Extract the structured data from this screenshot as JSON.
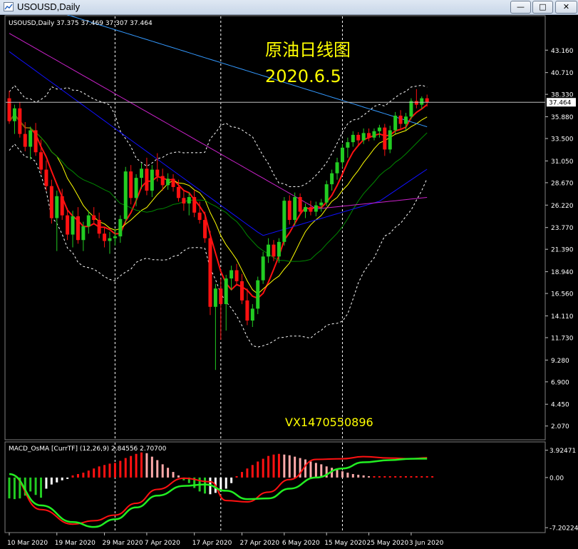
{
  "window": {
    "title": "USOUSD,Daily",
    "minimize_glyph": "—",
    "restore_glyph": "□",
    "close_glyph": "✕"
  },
  "colors": {
    "background": "#000000",
    "bull": "#22cc22",
    "bear": "#ff1111",
    "ma5": "#ff1111",
    "ma10": "#ffff00",
    "ma20": "#008800",
    "ma60": "#1010ff",
    "ma120": "#cc22cc",
    "ma240": "#3399ff",
    "band": "#ffffff",
    "macd_line": "#ff1111",
    "signal_line": "#22ee22",
    "hist_bear": "#ff1111",
    "hist_bull_pink": "#ffaaaa",
    "hist_white": "#ffffff",
    "hist_green": "#22cc22",
    "price_line": "#c0c0c0"
  },
  "chart_data": [
    {
      "type": "candlestick",
      "symbol_label": "USOUSD,Daily",
      "ohlc_readout": "37.375 37.469 37.307 37.464",
      "annotation_title": "原油日线图",
      "annotation_date": "2020.6.5",
      "watermark": "VX1470550896",
      "current_price_label": "37.464",
      "current_price": 37.464,
      "ylim": [
        0.8,
        45.6
      ],
      "y_ticks": [
        "43.160",
        "40.710",
        "38.330",
        "35.880",
        "33.500",
        "31.050",
        "28.670",
        "26.220",
        "23.770",
        "21.390",
        "18.940",
        "16.560",
        "14.110",
        "11.730",
        "9.280",
        "6.900",
        "4.450",
        "2.070"
      ],
      "x_ticks": [
        "10 Mar 2020",
        "19 Mar 2020",
        "29 Mar 2020",
        "7 Apr 2020",
        "17 Apr 2020",
        "27 Apr 2020",
        "6 May 2020",
        "15 May 2020",
        "25 May 2020",
        "3 Jun 2020"
      ],
      "x_tick_index": [
        0,
        9,
        18,
        26,
        35,
        44,
        52,
        60,
        68,
        76
      ],
      "period_separators_index": [
        -3,
        20,
        40,
        63
      ],
      "candles": [
        {
          "o": 37.9,
          "h": 38.7,
          "l": 35.1,
          "c": 35.4
        },
        {
          "o": 35.4,
          "h": 37.2,
          "l": 34.0,
          "c": 36.8
        },
        {
          "o": 36.8,
          "h": 37.5,
          "l": 33.6,
          "c": 34.0
        },
        {
          "o": 34.0,
          "h": 35.3,
          "l": 32.1,
          "c": 32.6
        },
        {
          "o": 32.6,
          "h": 34.8,
          "l": 31.2,
          "c": 34.4
        },
        {
          "o": 34.4,
          "h": 35.2,
          "l": 31.6,
          "c": 32.0
        },
        {
          "o": 32.0,
          "h": 33.4,
          "l": 29.6,
          "c": 30.1
        },
        {
          "o": 30.1,
          "h": 31.1,
          "l": 27.8,
          "c": 28.3
        },
        {
          "o": 28.3,
          "h": 29.0,
          "l": 24.2,
          "c": 24.8
        },
        {
          "o": 24.8,
          "h": 27.8,
          "l": 21.2,
          "c": 27.2
        },
        {
          "o": 27.2,
          "h": 28.0,
          "l": 24.6,
          "c": 25.1
        },
        {
          "o": 25.1,
          "h": 25.9,
          "l": 22.4,
          "c": 23.0
        },
        {
          "o": 23.0,
          "h": 25.6,
          "l": 21.6,
          "c": 25.0
        },
        {
          "o": 25.0,
          "h": 26.0,
          "l": 22.0,
          "c": 22.4
        },
        {
          "o": 22.4,
          "h": 24.4,
          "l": 21.2,
          "c": 23.9
        },
        {
          "o": 23.9,
          "h": 25.6,
          "l": 23.1,
          "c": 25.1
        },
        {
          "o": 25.1,
          "h": 26.0,
          "l": 24.2,
          "c": 24.6
        },
        {
          "o": 24.6,
          "h": 25.4,
          "l": 22.6,
          "c": 23.1
        },
        {
          "o": 23.1,
          "h": 23.8,
          "l": 21.6,
          "c": 22.3
        },
        {
          "o": 22.3,
          "h": 23.3,
          "l": 20.9,
          "c": 22.6
        },
        {
          "o": 22.6,
          "h": 23.6,
          "l": 21.8,
          "c": 22.8
        },
        {
          "o": 22.8,
          "h": 25.1,
          "l": 22.1,
          "c": 24.7
        },
        {
          "o": 24.7,
          "h": 30.4,
          "l": 24.2,
          "c": 29.9
        },
        {
          "o": 29.9,
          "h": 30.6,
          "l": 26.3,
          "c": 27.0
        },
        {
          "o": 27.0,
          "h": 29.6,
          "l": 26.1,
          "c": 29.2
        },
        {
          "o": 29.2,
          "h": 30.8,
          "l": 28.0,
          "c": 30.2
        },
        {
          "o": 30.2,
          "h": 31.4,
          "l": 27.3,
          "c": 27.8
        },
        {
          "o": 27.8,
          "h": 30.6,
          "l": 27.1,
          "c": 30.1
        },
        {
          "o": 30.1,
          "h": 31.9,
          "l": 28.8,
          "c": 29.4
        },
        {
          "o": 29.4,
          "h": 30.2,
          "l": 27.8,
          "c": 28.4
        },
        {
          "o": 28.4,
          "h": 29.7,
          "l": 27.9,
          "c": 29.1
        },
        {
          "o": 29.1,
          "h": 29.6,
          "l": 27.7,
          "c": 28.2
        },
        {
          "o": 28.2,
          "h": 29.0,
          "l": 26.6,
          "c": 27.0
        },
        {
          "o": 27.0,
          "h": 27.8,
          "l": 25.6,
          "c": 26.4
        },
        {
          "o": 26.4,
          "h": 27.6,
          "l": 25.1,
          "c": 27.1
        },
        {
          "o": 27.1,
          "h": 27.9,
          "l": 24.9,
          "c": 25.4
        },
        {
          "o": 25.4,
          "h": 26.6,
          "l": 24.2,
          "c": 24.6
        },
        {
          "o": 24.6,
          "h": 25.5,
          "l": 22.1,
          "c": 22.6
        },
        {
          "o": 22.6,
          "h": 23.4,
          "l": 14.2,
          "c": 15.1
        },
        {
          "o": 15.1,
          "h": 17.6,
          "l": 8.2,
          "c": 17.1
        },
        {
          "o": 17.1,
          "h": 18.2,
          "l": 11.5,
          "c": 15.4
        },
        {
          "o": 15.4,
          "h": 18.6,
          "l": 12.5,
          "c": 18.2
        },
        {
          "o": 18.2,
          "h": 19.6,
          "l": 16.9,
          "c": 19.1
        },
        {
          "o": 19.1,
          "h": 19.8,
          "l": 17.4,
          "c": 17.9
        },
        {
          "o": 17.9,
          "h": 18.7,
          "l": 15.4,
          "c": 15.8
        },
        {
          "o": 15.8,
          "h": 17.1,
          "l": 13.1,
          "c": 13.6
        },
        {
          "o": 13.6,
          "h": 15.4,
          "l": 12.9,
          "c": 14.9
        },
        {
          "o": 14.9,
          "h": 18.4,
          "l": 14.3,
          "c": 18.0
        },
        {
          "o": 18.0,
          "h": 21.1,
          "l": 17.6,
          "c": 20.6
        },
        {
          "o": 20.6,
          "h": 22.6,
          "l": 19.9,
          "c": 21.9
        },
        {
          "o": 21.9,
          "h": 22.4,
          "l": 20.1,
          "c": 20.6
        },
        {
          "o": 20.6,
          "h": 22.6,
          "l": 19.9,
          "c": 22.2
        },
        {
          "o": 22.2,
          "h": 27.1,
          "l": 21.8,
          "c": 26.7
        },
        {
          "o": 26.7,
          "h": 27.3,
          "l": 24.1,
          "c": 24.6
        },
        {
          "o": 24.6,
          "h": 27.6,
          "l": 24.0,
          "c": 27.1
        },
        {
          "o": 27.1,
          "h": 27.5,
          "l": 25.1,
          "c": 25.5
        },
        {
          "o": 25.5,
          "h": 26.4,
          "l": 24.8,
          "c": 26.0
        },
        {
          "o": 26.0,
          "h": 26.7,
          "l": 25.1,
          "c": 25.5
        },
        {
          "o": 25.5,
          "h": 26.6,
          "l": 25.0,
          "c": 26.2
        },
        {
          "o": 26.2,
          "h": 26.9,
          "l": 25.5,
          "c": 26.5
        },
        {
          "o": 26.5,
          "h": 28.9,
          "l": 26.1,
          "c": 28.5
        },
        {
          "o": 28.5,
          "h": 30.1,
          "l": 27.8,
          "c": 29.7
        },
        {
          "o": 29.7,
          "h": 31.4,
          "l": 29.0,
          "c": 30.9
        },
        {
          "o": 30.9,
          "h": 32.9,
          "l": 30.3,
          "c": 32.5
        },
        {
          "o": 32.5,
          "h": 33.6,
          "l": 31.4,
          "c": 33.1
        },
        {
          "o": 33.1,
          "h": 34.3,
          "l": 32.6,
          "c": 33.9
        },
        {
          "o": 33.9,
          "h": 34.2,
          "l": 32.8,
          "c": 33.3
        },
        {
          "o": 33.3,
          "h": 34.6,
          "l": 32.9,
          "c": 34.1
        },
        {
          "o": 34.1,
          "h": 34.6,
          "l": 33.2,
          "c": 33.6
        },
        {
          "o": 33.6,
          "h": 34.6,
          "l": 33.3,
          "c": 34.3
        },
        {
          "o": 34.3,
          "h": 35.0,
          "l": 33.6,
          "c": 34.7
        },
        {
          "o": 34.7,
          "h": 35.1,
          "l": 31.6,
          "c": 32.3
        },
        {
          "o": 32.3,
          "h": 34.9,
          "l": 31.9,
          "c": 34.4
        },
        {
          "o": 34.4,
          "h": 36.4,
          "l": 34.0,
          "c": 36.0
        },
        {
          "o": 36.0,
          "h": 36.6,
          "l": 34.5,
          "c": 35.1
        },
        {
          "o": 35.1,
          "h": 36.3,
          "l": 34.4,
          "c": 35.9
        },
        {
          "o": 35.9,
          "h": 37.9,
          "l": 35.6,
          "c": 37.6
        },
        {
          "o": 37.6,
          "h": 38.9,
          "l": 36.8,
          "c": 37.2
        },
        {
          "o": 37.2,
          "h": 38.1,
          "l": 36.7,
          "c": 37.9
        },
        {
          "o": 37.9,
          "h": 38.3,
          "l": 37.0,
          "c": 37.464
        }
      ]
    },
    {
      "type": "bar+line",
      "indicator_label": "MACD_OsMA [CurrTF] (12,26,9) 2.84556 2.70700",
      "ylim": [
        -7.6,
        4.4
      ],
      "y_ticks": [
        "3.92471",
        "0.00",
        "-7.20224"
      ],
      "macd_start": 0.5,
      "macd_step_index": [
        0,
        6,
        12,
        16,
        20,
        24,
        28,
        33,
        38,
        41,
        45,
        49,
        53,
        58,
        63,
        67,
        72,
        76,
        79
      ],
      "macd": [
        0.5,
        -4.6,
        -6.7,
        -6.2,
        -5.4,
        -3.7,
        -1.7,
        -0.1,
        -0.6,
        -3.3,
        -3.5,
        -2.1,
        -0.3,
        2.6,
        2.7,
        3.0,
        2.8,
        2.7,
        2.85
      ],
      "signal_step_index": [
        0,
        6,
        12,
        16,
        20,
        24,
        28,
        33,
        37,
        41,
        45,
        49,
        53,
        58,
        63,
        67,
        72,
        76,
        79
      ],
      "signal": [
        0.5,
        -4.0,
        -6.4,
        -7.1,
        -6.0,
        -4.3,
        -2.6,
        -1.2,
        -1.0,
        -1.9,
        -3.1,
        -3.0,
        -1.6,
        0.0,
        1.3,
        2.2,
        2.5,
        2.7,
        2.71
      ],
      "histogram": [
        -3.0,
        -3.1,
        -3.0,
        -2.6,
        -2.0,
        -2.5,
        -2.9,
        -1.6,
        -1.0,
        -0.7,
        -0.4,
        -0.2,
        0.3,
        0.5,
        0.7,
        1.0,
        1.3,
        1.6,
        1.8,
        2.0,
        2.1,
        2.4,
        2.8,
        3.1,
        3.4,
        3.6,
        3.5,
        3.0,
        2.5,
        1.9,
        1.4,
        0.8,
        0.3,
        -0.4,
        -0.8,
        -1.5,
        -2.0,
        -2.3,
        -2.4,
        -2.2,
        -2.0,
        -1.6,
        -0.8,
        0.2,
        0.8,
        1.3,
        1.8,
        2.3,
        2.7,
        3.1,
        3.3,
        3.4,
        3.3,
        3.2,
        3.0,
        2.8,
        2.6,
        2.3,
        2.1,
        1.9,
        1.6,
        1.4,
        1.1,
        0.9,
        0.7,
        0.5,
        0.4,
        0.3,
        0.2,
        0.2,
        0.2,
        0.2,
        0.2,
        0.2,
        0.2,
        0.2,
        0.2,
        0.2,
        0.2,
        0.2,
        0.2
      ]
    }
  ]
}
